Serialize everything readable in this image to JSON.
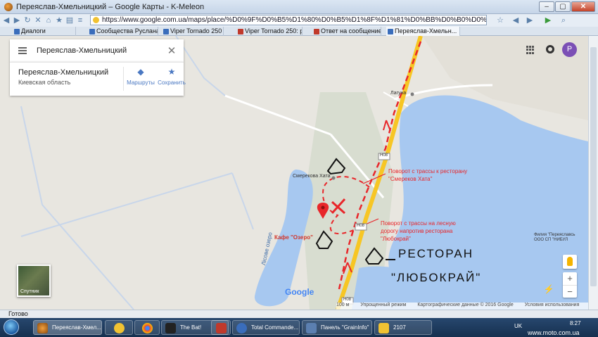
{
  "window": {
    "title": "Переяслав-Хмельницкий – Google Карты - K-Meleon"
  },
  "nav": {
    "url": "https://www.google.com.ua/maps/place/%D0%9F%D0%B5%D1%80%D0%B5%D1%8F%D1%81%D0%BB%D0%B0%D0%B2-%D0%A5%D0%BC%D0%B5%D0%BB%D1%8C"
  },
  "tabs": [
    {
      "label": "Диалоги"
    },
    {
      "label": "Сообщества Руслана..."
    },
    {
      "label": "Viper Tornado 250"
    },
    {
      "label": "Viper Tornado 250: ре..."
    },
    {
      "label": "Ответ на сообщение ..."
    },
    {
      "label": "Переяслав-Хмельн..."
    }
  ],
  "search": {
    "query": "Переяслав-Хмельницкий"
  },
  "place": {
    "name": "Переяслав-Хмельницкий",
    "region": "Киевская область",
    "actions": [
      {
        "label": "Маршруты",
        "icon": "directions-icon"
      },
      {
        "label": "Сохранить",
        "icon": "star-icon"
      }
    ]
  },
  "account": {
    "avatar_letter": "P",
    "avatar_color": "#7b4fb5"
  },
  "map": {
    "labels": {
      "laguna": "Лагуна",
      "smerekova": "Смерекова Хата",
      "kafe": "Кафе \"Озеро\"",
      "lake": "Лісове озеро",
      "filial_line1": "Филия \"Переяславсь",
      "filial_line2": "ООО СП \"НИБУЛ",
      "road_n08_a": "H08",
      "road_n08_b": "H08",
      "road_n08_c": "H08"
    },
    "annotations": {
      "note1_line1": "Поворот с трассы к ресторану",
      "note1_line2": "\"Смереков Хата\"",
      "note2_line1": "Поворот с трассы на лесную",
      "note2_line2": "дорогу напротив ресторана",
      "note2_line3": "\"Любокрай\"",
      "handwriting_line1": "РЕСТОРАН",
      "handwriting_line2": "\"ЛЮБОКРАЙ\""
    },
    "satellite_label": "Спутник",
    "google_logo": "Google",
    "accent_red": "#e8262a",
    "road_yellow": "#f7c624"
  },
  "attribution": {
    "scale": "100 м",
    "simplified": "Упрощенный режим",
    "copyright": "Картографические данные © 2016 Google",
    "terms": "Условия использования"
  },
  "status": {
    "text": "Готово"
  },
  "taskbar": {
    "items": [
      {
        "label": "Переяслав-Хмел..."
      },
      {
        "label": ""
      },
      {
        "label": ""
      },
      {
        "label": "The Bat!"
      },
      {
        "label": ""
      },
      {
        "label": "Total Commande..."
      },
      {
        "label": "Панель \"GrainInfo\""
      },
      {
        "label": "2107"
      }
    ],
    "lang": "UK",
    "time": "8:27",
    "watermark": "www.moto.com.ua"
  }
}
